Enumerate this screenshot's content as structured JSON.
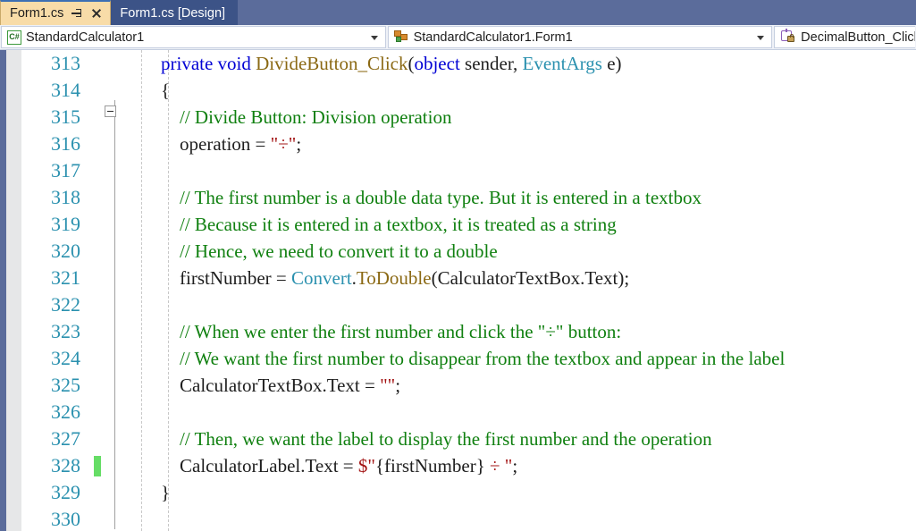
{
  "window": {
    "tabs": [
      {
        "label": "Form1.cs",
        "state": "active",
        "pin_icon": "pin-icon",
        "close_icon": "close-icon"
      },
      {
        "label": "Form1.cs [Design]",
        "state": "inactive"
      }
    ]
  },
  "navbar": {
    "project_dropdown": {
      "icon": "csharp-project-icon",
      "value": "StandardCalculator1",
      "arrow": "chevron-down-icon"
    },
    "class_dropdown": {
      "icon": "class-icon",
      "value": "StandardCalculator1.Form1",
      "arrow": "chevron-down-icon"
    },
    "member_dropdown": {
      "icon": "method-private-icon",
      "value": "DecimalButton_Click"
    }
  },
  "editor": {
    "first_line_number": 313,
    "line_count": 18,
    "change_bar_line": 328,
    "outline_collapse_line": 313,
    "colors": {
      "keyword": "#0000D4",
      "type": "#2B91AF",
      "method": "#8B6914",
      "comment": "#108010",
      "string": "#A31515",
      "linenumber": "#2B91AF",
      "changebar": "#66DD66",
      "tab_active_bg": "#F8DCA8",
      "tab_inactive_bg": "#3C5387",
      "chrome_bg": "#5B6C9B"
    },
    "lines": [
      {
        "n": 313,
        "tokens": [
          {
            "t": "kw",
            "s": "private void "
          },
          {
            "t": "mth",
            "s": "DivideButton_Click"
          },
          {
            "t": "pln",
            "s": "("
          },
          {
            "t": "kw",
            "s": "object"
          },
          {
            "t": "pln",
            "s": " sender, "
          },
          {
            "t": "typ",
            "s": "EventArgs"
          },
          {
            "t": "pln",
            "s": " e)"
          }
        ]
      },
      {
        "n": 314,
        "tokens": [
          {
            "t": "pln",
            "s": "{"
          }
        ]
      },
      {
        "n": 315,
        "tokens": [
          {
            "t": "cmt",
            "s": "    // Divide Button: Division operation"
          }
        ]
      },
      {
        "n": 316,
        "tokens": [
          {
            "t": "pln",
            "s": "    operation = "
          },
          {
            "t": "str",
            "s": "\"÷\""
          },
          {
            "t": "pln",
            "s": ";"
          }
        ]
      },
      {
        "n": 317,
        "tokens": []
      },
      {
        "n": 318,
        "tokens": [
          {
            "t": "cmt",
            "s": "    // The first number is a double data type. But it is entered in a textbox"
          }
        ]
      },
      {
        "n": 319,
        "tokens": [
          {
            "t": "cmt",
            "s": "    // Because it is entered in a textbox, it is treated as a string"
          }
        ]
      },
      {
        "n": 320,
        "tokens": [
          {
            "t": "cmt",
            "s": "    // Hence, we need to convert it to a double"
          }
        ]
      },
      {
        "n": 321,
        "tokens": [
          {
            "t": "pln",
            "s": "    firstNumber = "
          },
          {
            "t": "typ",
            "s": "Convert"
          },
          {
            "t": "pln",
            "s": "."
          },
          {
            "t": "mth",
            "s": "ToDouble"
          },
          {
            "t": "pln",
            "s": "(CalculatorTextBox.Text);"
          }
        ]
      },
      {
        "n": 322,
        "tokens": []
      },
      {
        "n": 323,
        "tokens": [
          {
            "t": "cmt",
            "s": "    // When we enter the first number and click the \"÷\" button:"
          }
        ]
      },
      {
        "n": 324,
        "tokens": [
          {
            "t": "cmt",
            "s": "    // We want the first number to disappear from the textbox and appear in the label"
          }
        ]
      },
      {
        "n": 325,
        "tokens": [
          {
            "t": "pln",
            "s": "    CalculatorTextBox.Text = "
          },
          {
            "t": "str",
            "s": "\"\""
          },
          {
            "t": "pln",
            "s": ";"
          }
        ]
      },
      {
        "n": 326,
        "tokens": []
      },
      {
        "n": 327,
        "tokens": [
          {
            "t": "cmt",
            "s": "    // Then, we want the label to display the first number and the operation"
          }
        ]
      },
      {
        "n": 328,
        "tokens": [
          {
            "t": "pln",
            "s": "    CalculatorLabel.Text = "
          },
          {
            "t": "str",
            "s": "$\""
          },
          {
            "t": "pln",
            "s": "{firstNumber}"
          },
          {
            "t": "str",
            "s": " ÷ \""
          },
          {
            "t": "pln",
            "s": ";"
          }
        ]
      },
      {
        "n": 329,
        "tokens": [
          {
            "t": "pln",
            "s": "}"
          }
        ]
      },
      {
        "n": 330,
        "tokens": []
      }
    ]
  }
}
